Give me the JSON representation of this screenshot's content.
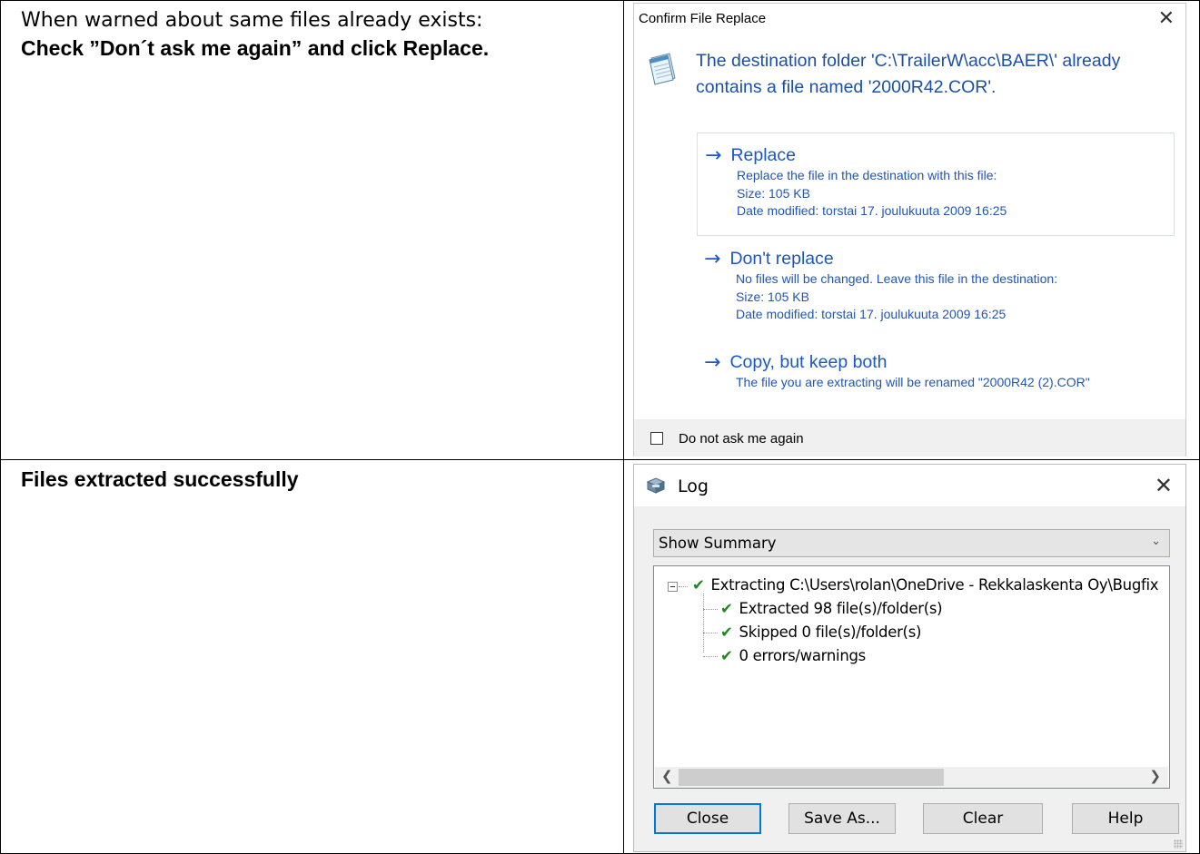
{
  "row1": {
    "line1": "When warned about same files already exists:",
    "line2": "Check ”Don´t ask me again” and click Replace."
  },
  "row2": {
    "text": "Files extracted successfully"
  },
  "confirm_dialog": {
    "title": "Confirm File Replace",
    "close_glyph": "✕",
    "heading": "The destination folder 'C:\\TrailerW\\acc\\BAER\\' already contains a file named '2000R42.COR'.",
    "icon": "notepad-icon",
    "options": [
      {
        "title": "Replace",
        "desc1": "Replace the file in the destination with this file:",
        "desc2": "Size: 105 KB",
        "desc3": "Date modified: torstai 17. joulukuuta 2009 16:25"
      },
      {
        "title": "Don't replace",
        "desc1": "No files will be changed. Leave this file in the destination:",
        "desc2": "Size: 105 KB",
        "desc3": "Date modified: torstai 17. joulukuuta 2009 16:25"
      },
      {
        "title": "Copy, but keep both",
        "desc1": "The file you are extracting will be renamed \"2000R42 (2).COR\""
      }
    ],
    "checkbox_label": "Do not ask me again",
    "arrow_glyph": "→"
  },
  "log_dialog": {
    "title": "Log",
    "close_glyph": "✕",
    "select_value": "Show Summary",
    "tree": {
      "root": "Extracting C:\\Users\\rolan\\OneDrive - Rekkalaskenta Oy\\Bugfix",
      "children": [
        "Extracted 98 file(s)/folder(s)",
        "Skipped 0 file(s)/folder(s)",
        "0 errors/warnings"
      ]
    },
    "buttons": {
      "close": "Close",
      "save_as": "Save As...",
      "clear": "Clear",
      "help": "Help"
    }
  },
  "colors": {
    "link_blue": "#1b58c4",
    "check_green": "#1d8a1d",
    "focus_blue": "#0078d7"
  }
}
